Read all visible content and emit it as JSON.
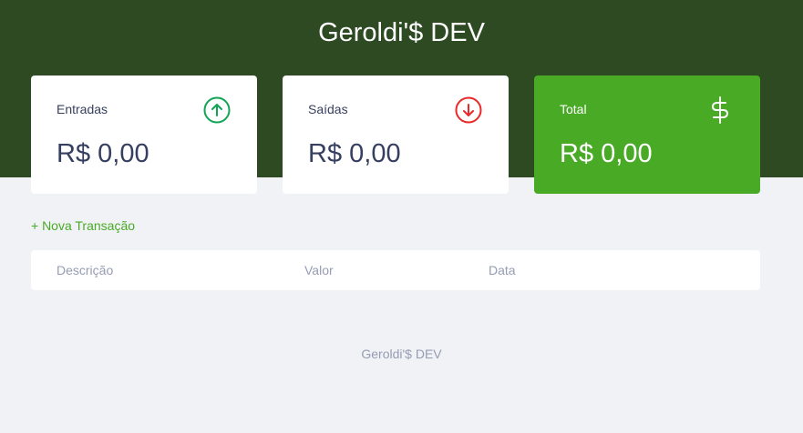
{
  "header": {
    "title": "Geroldi'$ DEV"
  },
  "cards": {
    "income": {
      "label": "Entradas",
      "value": "R$ 0,00",
      "icon": "arrow-up-circle-icon",
      "color": "#12a454"
    },
    "expense": {
      "label": "Saídas",
      "value": "R$ 0,00",
      "icon": "arrow-down-circle-icon",
      "color": "#e92929"
    },
    "total": {
      "label": "Total",
      "value": "R$ 0,00",
      "icon": "dollar-sign-icon",
      "color": "#49aa26"
    }
  },
  "actions": {
    "new_transaction": "+ Nova Transação"
  },
  "table": {
    "columns": [
      "Descrição",
      "Valor",
      "Data"
    ],
    "rows": []
  },
  "footer": {
    "text": "Geroldi'$ DEV"
  },
  "colors": {
    "header_bg": "#2d4a22",
    "page_bg": "#f0f2f5",
    "accent": "#49aa26",
    "muted_text": "#969cb3",
    "text": "#363f5f"
  }
}
